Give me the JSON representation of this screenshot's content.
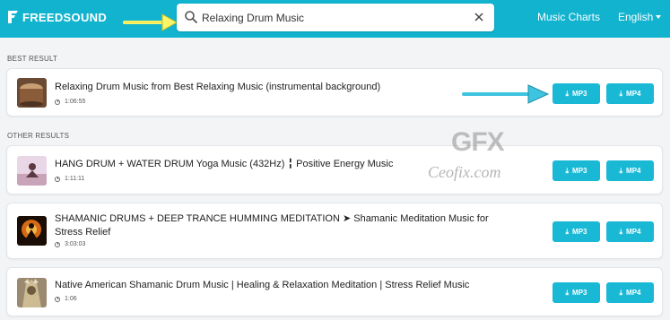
{
  "app": {
    "brand": "FREEDSOUND",
    "accent": "#11b3cf",
    "button_color": "#19b9d6"
  },
  "search": {
    "value": "Relaxing Drum Music",
    "placeholder": ""
  },
  "nav": {
    "charts": "Music Charts",
    "language": "English"
  },
  "sections": {
    "best": "BEST RESULT",
    "other": "OTHER RESULTS"
  },
  "best": {
    "title": "Relaxing Drum Music from Best Relaxing Music (instrumental background)",
    "duration": "1:06:55",
    "mp3": "MP3",
    "mp4": "MP4"
  },
  "others": [
    {
      "title": "HANG DRUM + WATER DRUM Yoga Music (432Hz) ╏ Positive Energy Music",
      "duration": "1:11:11",
      "mp3": "MP3",
      "mp4": "MP4"
    },
    {
      "title": "SHAMANIC DRUMS + DEEP TRANCE HUMMING MEDITATION ➤ Shamanic Meditation Music for Stress Relief",
      "duration": "3:03:03",
      "mp3": "MP3",
      "mp4": "MP4"
    },
    {
      "title": "Native American Shamanic Drum Music | Healing & Relaxation Meditation | Stress Relief Music",
      "duration": "1:06",
      "mp3": "MP3",
      "mp4": "MP4"
    }
  ],
  "watermark": {
    "logo": "GFX",
    "site": "Ceofix.com"
  }
}
